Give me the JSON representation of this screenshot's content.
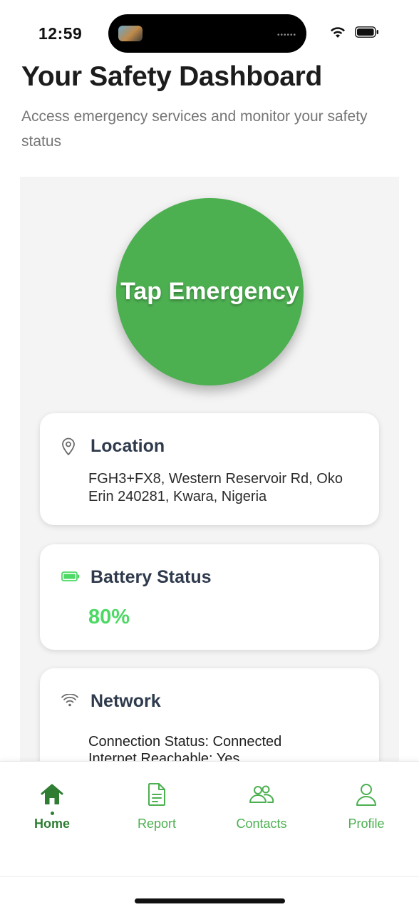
{
  "status_bar": {
    "time": "12:59",
    "icons": [
      "signal-icon",
      "wifi-icon",
      "battery-icon"
    ]
  },
  "header": {
    "title": "Your Safety Dashboard",
    "subtitle": "Access emergency services and monitor your safety status"
  },
  "emergency": {
    "label": "Tap Emergency",
    "color": "#4caf50"
  },
  "location": {
    "title": "Location",
    "icon": "map-pin-icon",
    "address": "FGH3+FX8, Western Reservoir Rd, Oko Erin 240281, Kwara, Nigeria"
  },
  "battery": {
    "title": "Battery Status",
    "icon": "battery-icon",
    "value": "80%",
    "value_color": "#4cd964"
  },
  "network": {
    "title": "Network",
    "icon": "wifi-icon",
    "connection_status": "Connection Status: Connected",
    "internet_reachable": "Internet Reachable: Yes"
  },
  "tabs": [
    {
      "label": "Home",
      "icon": "home-icon",
      "active": true
    },
    {
      "label": "Report",
      "icon": "document-icon",
      "active": false
    },
    {
      "label": "Contacts",
      "icon": "users-icon",
      "active": false
    },
    {
      "label": "Profile",
      "icon": "user-icon",
      "active": false
    }
  ],
  "colors": {
    "accent": "#4caf50",
    "active_tab": "#2e7d32",
    "card_title": "#2f3a4c"
  }
}
